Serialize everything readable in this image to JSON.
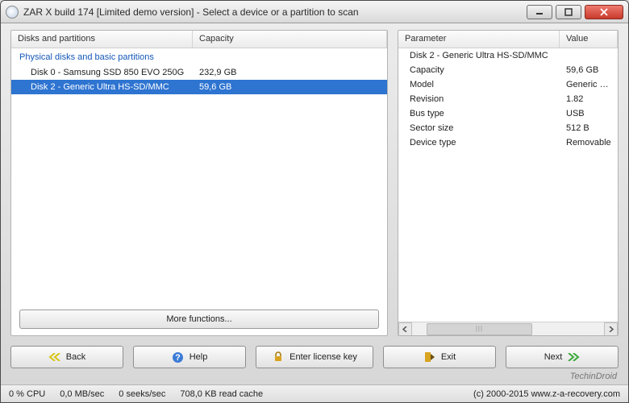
{
  "title": "ZAR X build 174 [Limited demo version] - Select a device or a partition to scan",
  "left": {
    "columns": {
      "name": "Disks and partitions",
      "capacity": "Capacity"
    },
    "group": "Physical disks and basic partitions",
    "rows": [
      {
        "name": "Disk 0 - Samsung SSD 850 EVO 250G",
        "capacity": "232,9 GB",
        "selected": false
      },
      {
        "name": "Disk 2 - Generic Ultra HS-SD/MMC",
        "capacity": "59,6 GB",
        "selected": true
      }
    ],
    "more_label": "More functions..."
  },
  "right": {
    "columns": {
      "param": "Parameter",
      "value": "Value"
    },
    "rows": [
      {
        "param": "Disk 2 - Generic Ultra HS-SD/MMC",
        "value": ""
      },
      {
        "param": "Capacity",
        "value": "59,6 GB"
      },
      {
        "param": "Model",
        "value": "Generic Ultra HS"
      },
      {
        "param": "Revision",
        "value": "1.82"
      },
      {
        "param": "Bus type",
        "value": "USB"
      },
      {
        "param": "Sector size",
        "value": "512 B"
      },
      {
        "param": "Device type",
        "value": "Removable"
      }
    ]
  },
  "buttons": {
    "back": "Back",
    "help": "Help",
    "license": "Enter license key",
    "exit": "Exit",
    "next": "Next"
  },
  "status": {
    "cpu": "0 % CPU",
    "mbs": "0,0 MB/sec",
    "seeks": "0 seeks/sec",
    "cache": "708,0 KB read cache",
    "copyright": "(c) 2000-2015 www.z-a-recovery.com"
  },
  "watermark": "TechinDroid"
}
